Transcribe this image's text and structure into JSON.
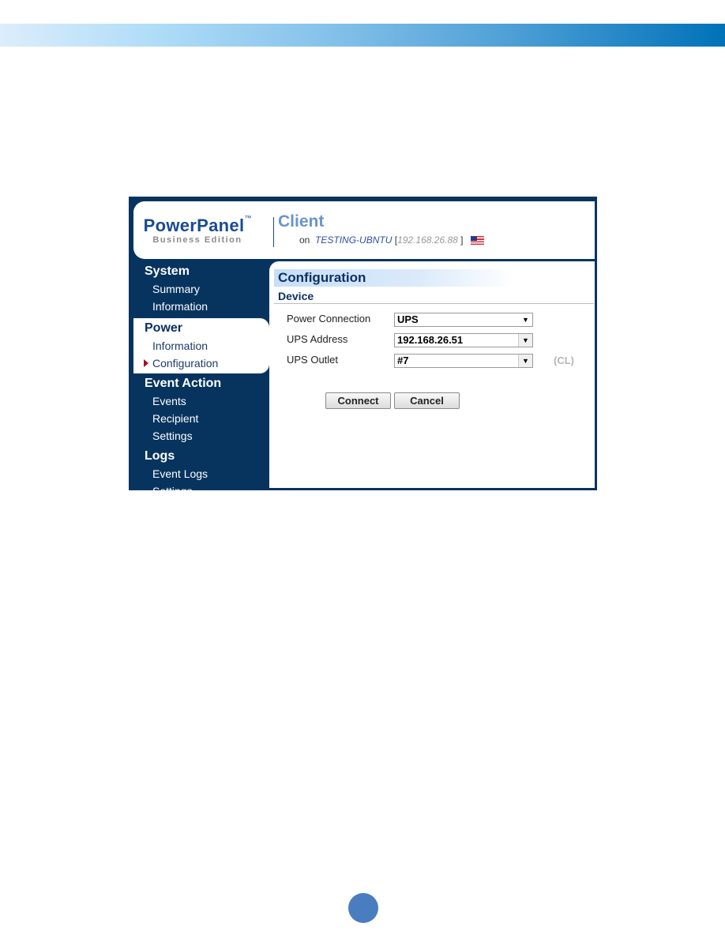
{
  "app": {
    "logo_main": "PowerPanel",
    "logo_tm": "™",
    "logo_sub": "Business Edition",
    "title": "Client",
    "host_prefix": "on",
    "host_name": "TESTING-UBNTU",
    "ip_open": "[",
    "host_ip": "192.168.26.88",
    "ip_close": "]",
    "flag_icon": "us-flag-icon"
  },
  "sidebar": {
    "sections": [
      {
        "title": "System",
        "items": [
          "Summary",
          "Information"
        ]
      },
      {
        "title": "Power",
        "items": [
          "Information",
          "Configuration"
        ],
        "active_item": "Configuration"
      },
      {
        "title": "Event Action",
        "items": [
          "Events",
          "Recipient",
          "Settings"
        ]
      },
      {
        "title": "Logs",
        "items": [
          "Event Logs",
          "Settings"
        ]
      }
    ]
  },
  "main": {
    "page_title": "Configuration",
    "section_title": "Device",
    "fields": [
      {
        "label": "Power Connection",
        "value": "UPS"
      },
      {
        "label": "UPS Address",
        "value": "192.168.26.51"
      },
      {
        "label": "UPS Outlet",
        "value": "#7",
        "note": "(CL)"
      }
    ],
    "buttons": {
      "connect": "Connect",
      "cancel": "Cancel"
    }
  },
  "colors": {
    "frame_navy": "#07345f",
    "brand_blue": "#1a4a94",
    "active_marker": "#a3131d",
    "page_dot": "#4a7cc0"
  }
}
